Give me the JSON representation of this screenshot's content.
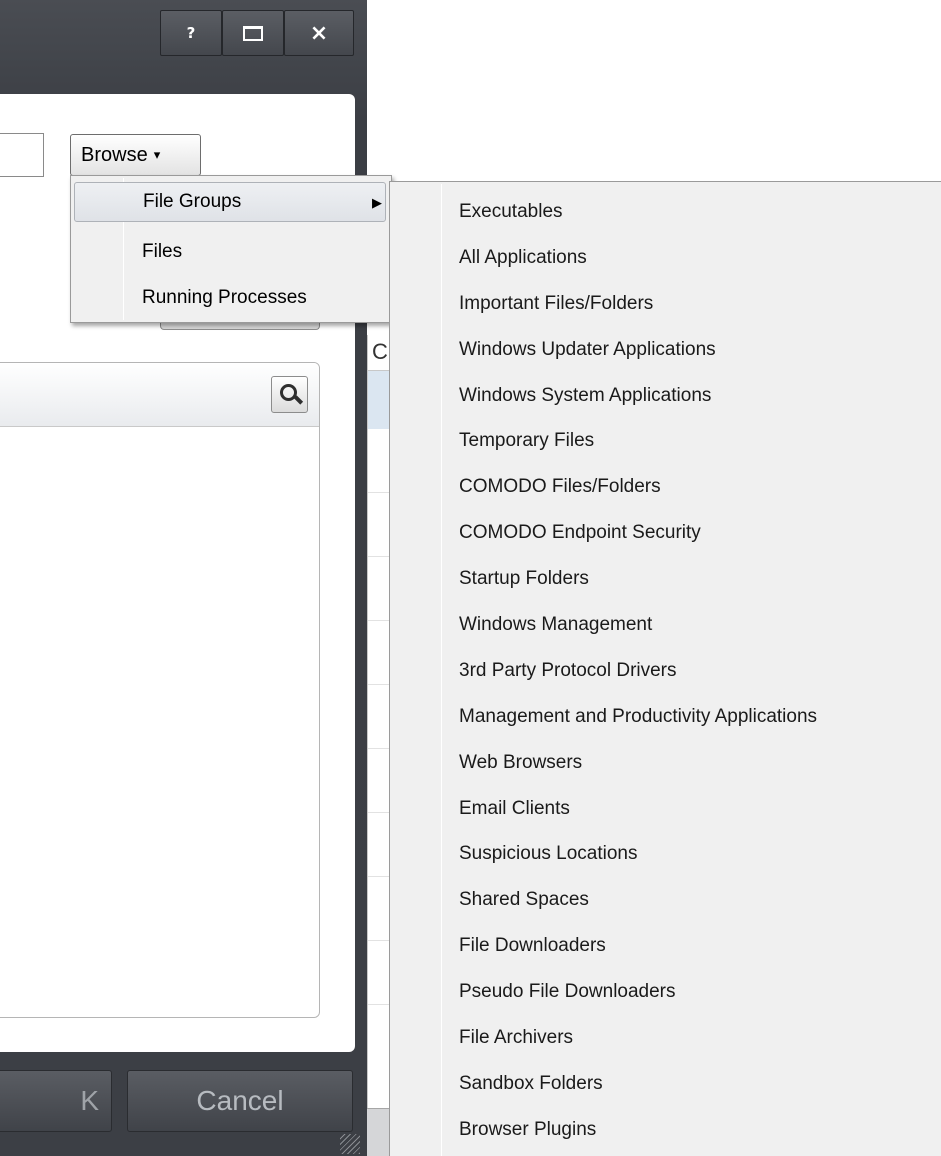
{
  "window": {
    "help_label": "?",
    "close_label": "×"
  },
  "browse": {
    "label": "Browse",
    "caret": "▾"
  },
  "context_menu": {
    "items": [
      {
        "label": "File Groups",
        "has_submenu": true,
        "highlighted": true
      },
      {
        "label": "Files"
      },
      {
        "label": "Running Processes"
      }
    ],
    "submenu_arrow": "▶"
  },
  "file_groups_submenu": {
    "items": [
      "Executables",
      "All Applications",
      "Important Files/Folders",
      "Windows Updater Applications",
      "Windows System Applications",
      "Temporary Files",
      "COMODO Files/Folders",
      "COMODO Endpoint Security",
      "Startup Folders",
      "Windows Management",
      "3rd Party Protocol Drivers",
      "Management and Productivity Applications",
      "Web Browsers",
      "Email Clients",
      "Suspicious Locations",
      "Shared Spaces",
      "File Downloaders",
      "Pseudo File Downloaders",
      "File Archivers",
      "Sandbox Folders",
      "Browser Plugins"
    ]
  },
  "footer": {
    "ok_label": "K",
    "cancel_label": "Cancel"
  },
  "background_window": {
    "header_fragment": "C"
  },
  "icons": {
    "search": "search-icon",
    "maximize": "maximize-icon",
    "close": "close-icon",
    "help": "help-icon",
    "resize_grip": "resize-grip-icon"
  }
}
